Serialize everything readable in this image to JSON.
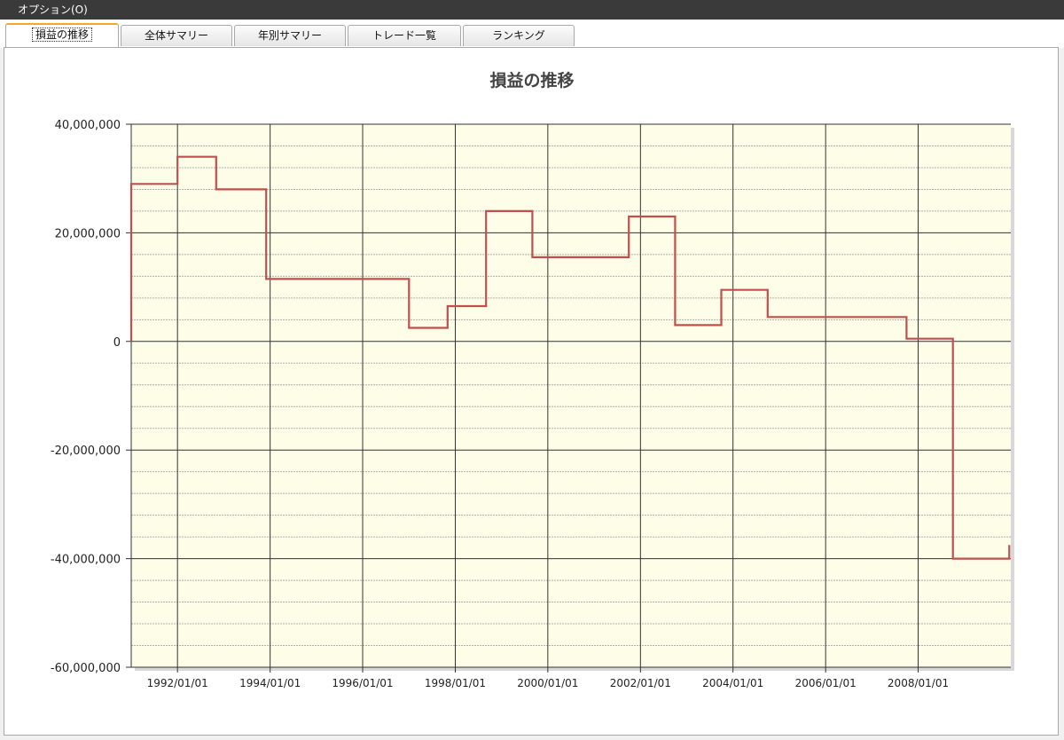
{
  "menu": {
    "options_label": "オプション(O)"
  },
  "tabs": [
    {
      "label": "損益の推移",
      "active": true
    },
    {
      "label": "全体サマリー",
      "active": false
    },
    {
      "label": "年別サマリー",
      "active": false
    },
    {
      "label": "トレード一覧",
      "active": false
    },
    {
      "label": "ランキング",
      "active": false
    }
  ],
  "chart_data": {
    "type": "line",
    "title": "損益の推移",
    "xlabel": "",
    "ylabel": "",
    "ylim": [
      -60000000,
      40000000
    ],
    "xlim": [
      "1991-01-01",
      "2010-01-01"
    ],
    "y_ticks": [
      40000000,
      20000000,
      0,
      -20000000,
      -40000000,
      -60000000
    ],
    "y_tick_labels": [
      "40,000,000",
      "20,000,000",
      "0",
      "-20,000,000",
      "-40,000,000",
      "-60,000,000"
    ],
    "x_tick_labels": [
      "1992/01/01",
      "1994/01/01",
      "1996/01/01",
      "1998/01/01",
      "2000/01/01",
      "2002/01/01",
      "2004/01/01",
      "2006/01/01",
      "2008/01/01"
    ],
    "grid": true,
    "colors": {
      "line": "#c0504d",
      "plot_bg": "#fdfde8",
      "grid_major": "#333333",
      "grid_minor": "#b0b0b0"
    },
    "series": [
      {
        "step": true,
        "points": [
          [
            "1991-01-01",
            0
          ],
          [
            "1991-01-01",
            29000000
          ],
          [
            "1992-01-01",
            29000000
          ],
          [
            "1992-01-01",
            34000000
          ],
          [
            "1992-11-01",
            34000000
          ],
          [
            "1992-11-01",
            28000000
          ],
          [
            "1993-12-01",
            28000000
          ],
          [
            "1993-12-01",
            11500000
          ],
          [
            "1997-01-01",
            11500000
          ],
          [
            "1997-01-01",
            2500000
          ],
          [
            "1997-11-01",
            2500000
          ],
          [
            "1997-11-01",
            6500000
          ],
          [
            "1998-09-01",
            6500000
          ],
          [
            "1998-09-01",
            24000000
          ],
          [
            "1999-09-01",
            24000000
          ],
          [
            "1999-09-01",
            15500000
          ],
          [
            "2001-10-01",
            15500000
          ],
          [
            "2001-10-01",
            23000000
          ],
          [
            "2002-10-01",
            23000000
          ],
          [
            "2002-10-01",
            3000000
          ],
          [
            "2003-10-01",
            3000000
          ],
          [
            "2003-10-01",
            9500000
          ],
          [
            "2004-10-01",
            9500000
          ],
          [
            "2004-10-01",
            4500000
          ],
          [
            "2007-10-01",
            4500000
          ],
          [
            "2007-10-01",
            500000
          ],
          [
            "2008-10-01",
            500000
          ],
          [
            "2008-10-01",
            -40000000
          ],
          [
            "2009-12-20",
            -40000000
          ],
          [
            "2009-12-20",
            -37500000
          ]
        ]
      }
    ]
  }
}
